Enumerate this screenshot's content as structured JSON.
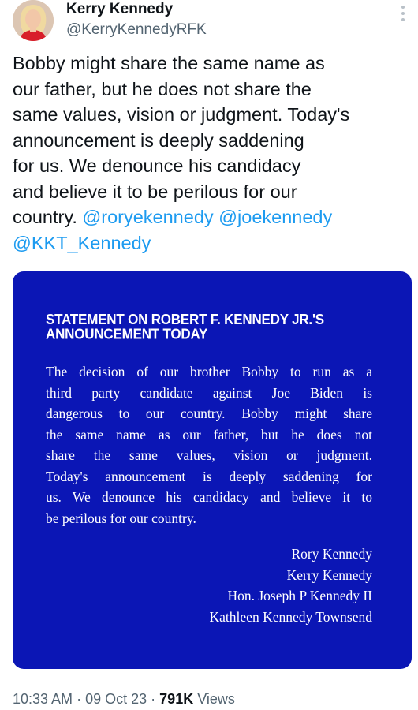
{
  "author": {
    "name": "Kerry Kennedy",
    "handle": "@KerryKennedyRFK",
    "avatar_icon": "profile-photo-icon"
  },
  "tweet": {
    "lines": [
      "Bobby might share the same name as",
      "our father, but he does not share the",
      "same values, vision or judgment. Today's",
      "announcement is deeply saddening",
      "for us. We denounce his candidacy",
      "and believe it to be perilous for our"
    ],
    "last_line_text": "country.",
    "mentions": [
      "@roryekennedy",
      "@joekennedy",
      "@KKT_Kennedy"
    ],
    "link_color": "#1d9bf0"
  },
  "statement": {
    "background_color": "#0b16b5",
    "title_lines": [
      "STATEMENT ON ROBERT F. KENNEDY JR.'S",
      "ANNOUNCEMENT TODAY"
    ],
    "body_lines": [
      "The decision of our brother Bobby to run as a",
      "third party candidate against Joe Biden is",
      "dangerous to our country. Bobby might share",
      "the same name as our father, but he does not",
      "share the same values, vision or judgment.",
      "Today's announcement is deeply saddening for",
      "us. We denounce his candidacy and believe it to",
      "be perilous for our country."
    ],
    "signatures": [
      "Rory Kennedy",
      "Kerry Kennedy",
      "Hon. Joseph P Kennedy II",
      "Kathleen Kennedy Townsend"
    ]
  },
  "meta": {
    "time": "10:33 AM",
    "date": "09 Oct 23",
    "views_count": "791K",
    "views_label": "Views",
    "separator": "·"
  },
  "more_icon": "more-vertical-icon"
}
